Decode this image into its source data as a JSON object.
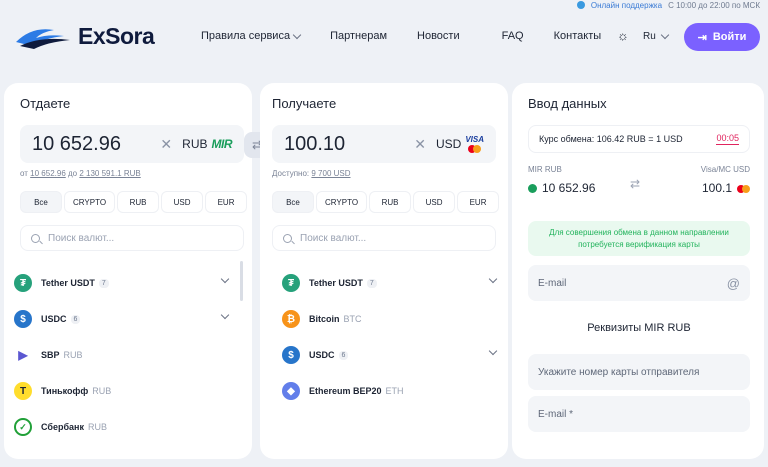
{
  "topbar": {
    "support_label": "Онлайн поддержка",
    "hours": "С 10:00 до 22:00 по МСК"
  },
  "brand": {
    "name": "ExSora"
  },
  "nav": [
    {
      "label": "Правила сервиса",
      "has_dropdown": true
    },
    {
      "label": "Партнерам",
      "has_dropdown": false
    },
    {
      "label": "Новости",
      "has_dropdown": false
    },
    {
      "label": "FAQ",
      "has_dropdown": false
    },
    {
      "label": "Контакты",
      "has_dropdown": false
    }
  ],
  "header": {
    "theme_icon": "sun-icon",
    "lang": "Ru",
    "login_label": "Войти",
    "accent": "#7b61ff"
  },
  "give": {
    "title": "Отдаете",
    "amount": "10 652.96",
    "currency": "RUB",
    "method_logo": "MIR",
    "limits_prefix": "от",
    "limit_min": "10 652.96",
    "limits_mid": "до",
    "limit_max": "2 130 591.1 RUB",
    "filters": [
      "Все",
      "CRYPTO",
      "RUB",
      "USD",
      "EUR"
    ],
    "search_placeholder": "Поиск валют...",
    "items": [
      {
        "name": "Tether USDT",
        "count": "7",
        "icon": "tether-icon",
        "color": "#26a17b",
        "glyph": "₮"
      },
      {
        "name": "USDC",
        "count": "6",
        "icon": "usdc-icon",
        "color": "#2775ca",
        "glyph": "$"
      },
      {
        "name": "SBP",
        "code": "RUB",
        "icon": "sbp-icon",
        "color": "#5b57d1",
        "glyph": "▶"
      },
      {
        "name": "Тинькофф",
        "code": "RUB",
        "icon": "tinkoff-icon",
        "color": "#ffdd2d",
        "glyph": "T"
      },
      {
        "name": "Сбербанк",
        "code": "RUB",
        "icon": "sber-icon",
        "color": "#21a038",
        "glyph": "✓"
      }
    ]
  },
  "get": {
    "title": "Получаете",
    "amount": "100.10",
    "currency": "USD",
    "method_logo": "VISA",
    "available_label": "Доступно:",
    "available_value": "9 700 USD",
    "filters": [
      "Все",
      "CRYPTO",
      "RUB",
      "USD",
      "EUR"
    ],
    "search_placeholder": "Поиск валют...",
    "items": [
      {
        "name": "Tether USDT",
        "count": "7",
        "icon": "tether-icon",
        "color": "#26a17b",
        "glyph": "₮"
      },
      {
        "name": "Bitcoin",
        "code": "BTC",
        "icon": "bitcoin-icon",
        "color": "#f7931a",
        "glyph": "₿"
      },
      {
        "name": "USDC",
        "count": "6",
        "icon": "usdc-icon",
        "color": "#2775ca",
        "glyph": "$"
      },
      {
        "name": "Ethereum BEP20",
        "code": "ETH",
        "icon": "ethereum-icon",
        "color": "#627eea",
        "glyph": "◆"
      }
    ]
  },
  "form": {
    "title": "Ввод данных",
    "rate_text": "Курс обмена: 106.42 RUB = 1 USD",
    "timer": "00:05",
    "from_label": "MIR RUB",
    "from_amount": "10 652.96",
    "to_label": "Visa/MC USD",
    "to_amount": "100.1",
    "notice": "Для совершения обмена в данном направлении потребуется верификация карты",
    "email_placeholder": "E-mail",
    "section_title": "Реквизиты MIR RUB",
    "card_placeholder": "Укажите номер карты отправителя",
    "email2_placeholder": "E-mail *"
  }
}
